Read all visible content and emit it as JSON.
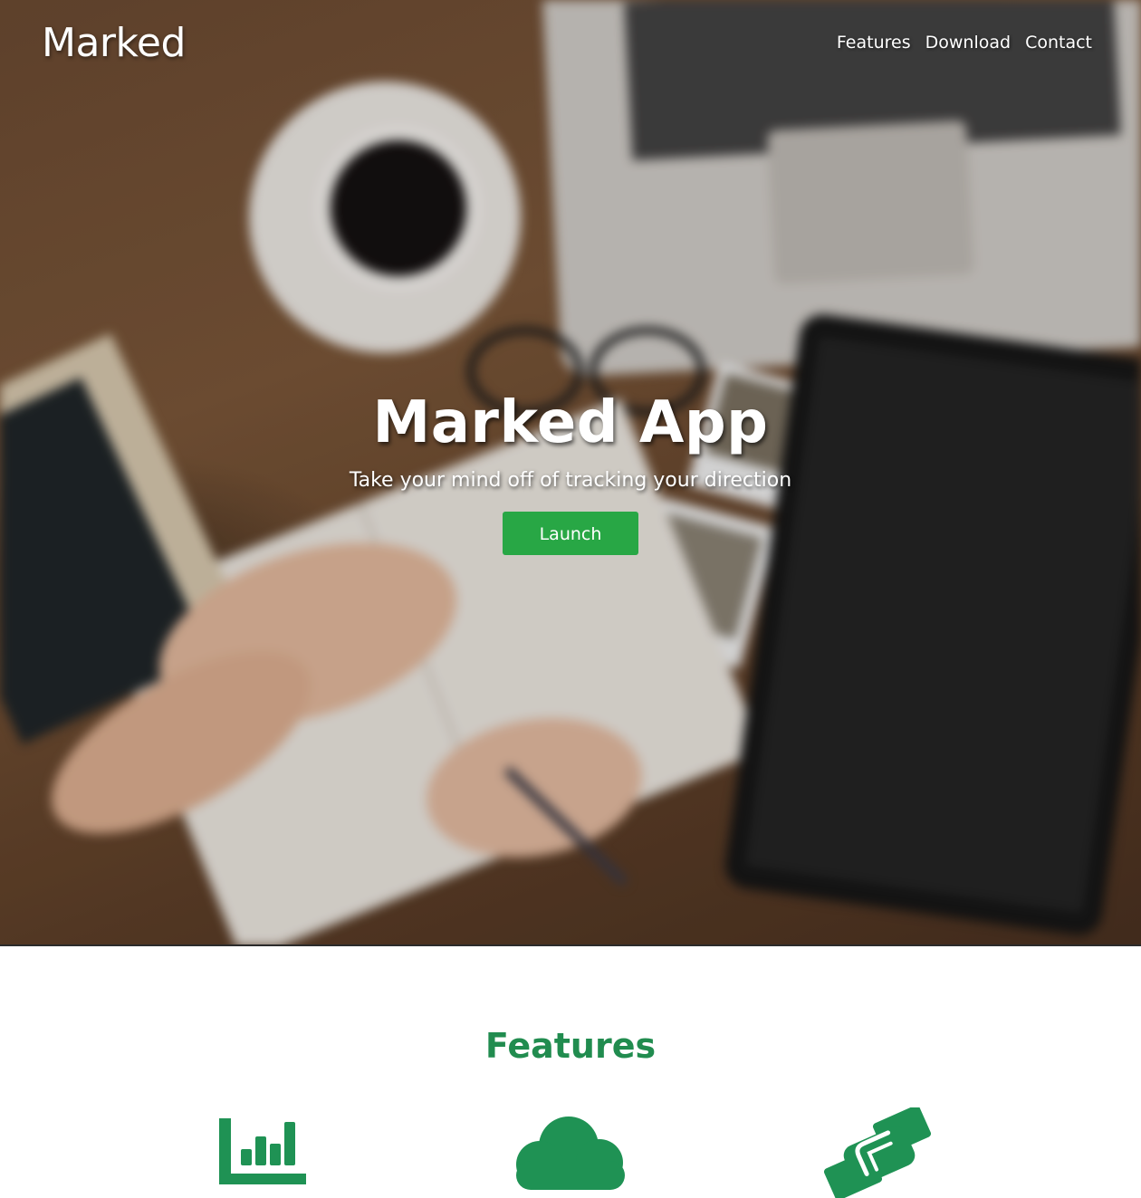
{
  "brand": "Marked",
  "nav": {
    "features": "Features",
    "download": "Download",
    "contact": "Contact"
  },
  "hero": {
    "title": "Marked App",
    "subtitle": "Take your mind off of tracking your direction",
    "button_label": "Launch"
  },
  "features": {
    "heading": "Features",
    "icons": [
      "bar-chart-icon",
      "cloud-icon",
      "handshake-icon"
    ]
  },
  "colors": {
    "accent_green": "#28a745",
    "heading_green": "#218c4f",
    "icon_green": "#1f9254"
  }
}
